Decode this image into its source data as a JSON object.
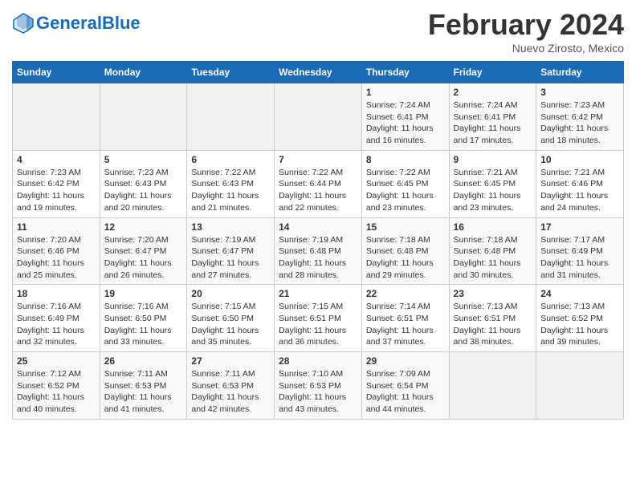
{
  "header": {
    "logo_text_normal": "General",
    "logo_text_blue": "Blue",
    "month_title": "February 2024",
    "location": "Nuevo Zirosto, Mexico"
  },
  "days_of_week": [
    "Sunday",
    "Monday",
    "Tuesday",
    "Wednesday",
    "Thursday",
    "Friday",
    "Saturday"
  ],
  "weeks": [
    [
      {
        "day": "",
        "info": ""
      },
      {
        "day": "",
        "info": ""
      },
      {
        "day": "",
        "info": ""
      },
      {
        "day": "",
        "info": ""
      },
      {
        "day": "1",
        "info": "Sunrise: 7:24 AM\nSunset: 6:41 PM\nDaylight: 11 hours\nand 16 minutes."
      },
      {
        "day": "2",
        "info": "Sunrise: 7:24 AM\nSunset: 6:41 PM\nDaylight: 11 hours\nand 17 minutes."
      },
      {
        "day": "3",
        "info": "Sunrise: 7:23 AM\nSunset: 6:42 PM\nDaylight: 11 hours\nand 18 minutes."
      }
    ],
    [
      {
        "day": "4",
        "info": "Sunrise: 7:23 AM\nSunset: 6:42 PM\nDaylight: 11 hours\nand 19 minutes."
      },
      {
        "day": "5",
        "info": "Sunrise: 7:23 AM\nSunset: 6:43 PM\nDaylight: 11 hours\nand 20 minutes."
      },
      {
        "day": "6",
        "info": "Sunrise: 7:22 AM\nSunset: 6:43 PM\nDaylight: 11 hours\nand 21 minutes."
      },
      {
        "day": "7",
        "info": "Sunrise: 7:22 AM\nSunset: 6:44 PM\nDaylight: 11 hours\nand 22 minutes."
      },
      {
        "day": "8",
        "info": "Sunrise: 7:22 AM\nSunset: 6:45 PM\nDaylight: 11 hours\nand 23 minutes."
      },
      {
        "day": "9",
        "info": "Sunrise: 7:21 AM\nSunset: 6:45 PM\nDaylight: 11 hours\nand 23 minutes."
      },
      {
        "day": "10",
        "info": "Sunrise: 7:21 AM\nSunset: 6:46 PM\nDaylight: 11 hours\nand 24 minutes."
      }
    ],
    [
      {
        "day": "11",
        "info": "Sunrise: 7:20 AM\nSunset: 6:46 PM\nDaylight: 11 hours\nand 25 minutes."
      },
      {
        "day": "12",
        "info": "Sunrise: 7:20 AM\nSunset: 6:47 PM\nDaylight: 11 hours\nand 26 minutes."
      },
      {
        "day": "13",
        "info": "Sunrise: 7:19 AM\nSunset: 6:47 PM\nDaylight: 11 hours\nand 27 minutes."
      },
      {
        "day": "14",
        "info": "Sunrise: 7:19 AM\nSunset: 6:48 PM\nDaylight: 11 hours\nand 28 minutes."
      },
      {
        "day": "15",
        "info": "Sunrise: 7:18 AM\nSunset: 6:48 PM\nDaylight: 11 hours\nand 29 minutes."
      },
      {
        "day": "16",
        "info": "Sunrise: 7:18 AM\nSunset: 6:48 PM\nDaylight: 11 hours\nand 30 minutes."
      },
      {
        "day": "17",
        "info": "Sunrise: 7:17 AM\nSunset: 6:49 PM\nDaylight: 11 hours\nand 31 minutes."
      }
    ],
    [
      {
        "day": "18",
        "info": "Sunrise: 7:16 AM\nSunset: 6:49 PM\nDaylight: 11 hours\nand 32 minutes."
      },
      {
        "day": "19",
        "info": "Sunrise: 7:16 AM\nSunset: 6:50 PM\nDaylight: 11 hours\nand 33 minutes."
      },
      {
        "day": "20",
        "info": "Sunrise: 7:15 AM\nSunset: 6:50 PM\nDaylight: 11 hours\nand 35 minutes."
      },
      {
        "day": "21",
        "info": "Sunrise: 7:15 AM\nSunset: 6:51 PM\nDaylight: 11 hours\nand 36 minutes."
      },
      {
        "day": "22",
        "info": "Sunrise: 7:14 AM\nSunset: 6:51 PM\nDaylight: 11 hours\nand 37 minutes."
      },
      {
        "day": "23",
        "info": "Sunrise: 7:13 AM\nSunset: 6:51 PM\nDaylight: 11 hours\nand 38 minutes."
      },
      {
        "day": "24",
        "info": "Sunrise: 7:13 AM\nSunset: 6:52 PM\nDaylight: 11 hours\nand 39 minutes."
      }
    ],
    [
      {
        "day": "25",
        "info": "Sunrise: 7:12 AM\nSunset: 6:52 PM\nDaylight: 11 hours\nand 40 minutes."
      },
      {
        "day": "26",
        "info": "Sunrise: 7:11 AM\nSunset: 6:53 PM\nDaylight: 11 hours\nand 41 minutes."
      },
      {
        "day": "27",
        "info": "Sunrise: 7:11 AM\nSunset: 6:53 PM\nDaylight: 11 hours\nand 42 minutes."
      },
      {
        "day": "28",
        "info": "Sunrise: 7:10 AM\nSunset: 6:53 PM\nDaylight: 11 hours\nand 43 minutes."
      },
      {
        "day": "29",
        "info": "Sunrise: 7:09 AM\nSunset: 6:54 PM\nDaylight: 11 hours\nand 44 minutes."
      },
      {
        "day": "",
        "info": ""
      },
      {
        "day": "",
        "info": ""
      }
    ]
  ]
}
